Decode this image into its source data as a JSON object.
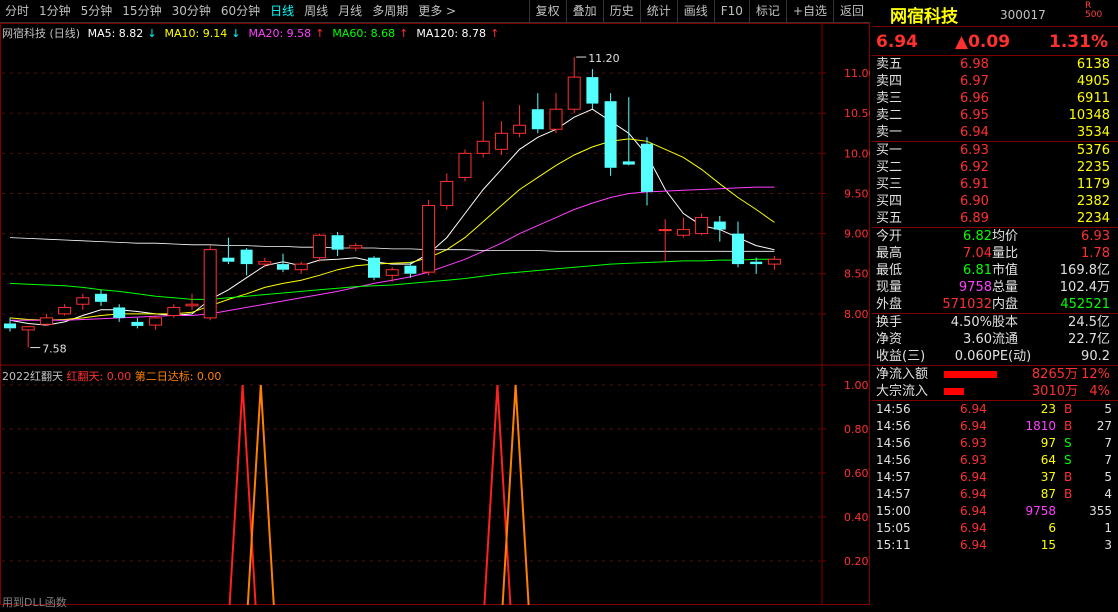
{
  "toolbar": {
    "periods": [
      "分时",
      "1分钟",
      "5分钟",
      "15分钟",
      "30分钟",
      "60分钟",
      "日线",
      "周线",
      "月线",
      "多周期",
      "更多 >"
    ],
    "active_index": 6,
    "buttons": [
      "复权",
      "叠加",
      "历史",
      "统计",
      "画线",
      "F10",
      "标记",
      "+自选",
      "返回"
    ]
  },
  "main_chart": {
    "title": "网宿科技 (日线)",
    "ma": [
      {
        "label": "MA5: 8.82",
        "arrow": "↓",
        "color": "#ffffff"
      },
      {
        "label": "MA10: 9.14",
        "arrow": "↓",
        "color": "#ffff00"
      },
      {
        "label": "MA20: 9.58",
        "arrow": "↑",
        "color": "#ff40ff"
      },
      {
        "label": "MA60: 8.68",
        "arrow": "↑",
        "color": "#00ff00"
      },
      {
        "label": "MA120: 8.78",
        "arrow": "↑",
        "color": "#ffffff"
      }
    ],
    "y_ticks": [
      "11.00",
      "10.50",
      "10.00",
      "9.50",
      "9.00",
      "8.50",
      "8.00"
    ],
    "high_label": "11.20",
    "low_label": "7.58",
    "candles": [
      {
        "o": 7.88,
        "h": 7.95,
        "l": 7.78,
        "c": 7.82
      },
      {
        "o": 7.8,
        "h": 7.85,
        "l": 7.58,
        "c": 7.84
      },
      {
        "o": 7.87,
        "h": 8.0,
        "l": 7.85,
        "c": 7.95
      },
      {
        "o": 8.0,
        "h": 8.12,
        "l": 7.98,
        "c": 8.08
      },
      {
        "o": 8.12,
        "h": 8.25,
        "l": 8.05,
        "c": 8.2
      },
      {
        "o": 8.25,
        "h": 8.3,
        "l": 8.1,
        "c": 8.15
      },
      {
        "o": 8.08,
        "h": 8.12,
        "l": 7.9,
        "c": 7.95
      },
      {
        "o": 7.9,
        "h": 7.95,
        "l": 7.82,
        "c": 7.85
      },
      {
        "o": 7.86,
        "h": 7.98,
        "l": 7.8,
        "c": 7.95
      },
      {
        "o": 7.98,
        "h": 8.12,
        "l": 7.95,
        "c": 8.08
      },
      {
        "o": 8.1,
        "h": 8.25,
        "l": 8.05,
        "c": 8.12
      },
      {
        "o": 7.95,
        "h": 8.85,
        "l": 7.92,
        "c": 8.8
      },
      {
        "o": 8.7,
        "h": 8.95,
        "l": 8.62,
        "c": 8.65
      },
      {
        "o": 8.8,
        "h": 8.82,
        "l": 8.48,
        "c": 8.62
      },
      {
        "o": 8.62,
        "h": 8.7,
        "l": 8.58,
        "c": 8.65
      },
      {
        "o": 8.62,
        "h": 8.75,
        "l": 8.52,
        "c": 8.55
      },
      {
        "o": 8.55,
        "h": 8.65,
        "l": 8.5,
        "c": 8.62
      },
      {
        "o": 8.7,
        "h": 9.0,
        "l": 8.65,
        "c": 8.98
      },
      {
        "o": 8.98,
        "h": 9.02,
        "l": 8.72,
        "c": 8.8
      },
      {
        "o": 8.82,
        "h": 8.88,
        "l": 8.78,
        "c": 8.85
      },
      {
        "o": 8.7,
        "h": 8.72,
        "l": 8.42,
        "c": 8.45
      },
      {
        "o": 8.48,
        "h": 8.58,
        "l": 8.4,
        "c": 8.55
      },
      {
        "o": 8.6,
        "h": 8.65,
        "l": 8.45,
        "c": 8.5
      },
      {
        "o": 8.52,
        "h": 9.42,
        "l": 8.48,
        "c": 9.35
      },
      {
        "o": 9.35,
        "h": 9.75,
        "l": 9.3,
        "c": 9.65
      },
      {
        "o": 9.7,
        "h": 10.05,
        "l": 9.65,
        "c": 10.0
      },
      {
        "o": 10.0,
        "h": 10.65,
        "l": 9.95,
        "c": 10.15
      },
      {
        "o": 10.05,
        "h": 10.4,
        "l": 9.98,
        "c": 10.25
      },
      {
        "o": 10.25,
        "h": 10.6,
        "l": 10.2,
        "c": 10.35
      },
      {
        "o": 10.55,
        "h": 10.75,
        "l": 10.25,
        "c": 10.3
      },
      {
        "o": 10.3,
        "h": 10.75,
        "l": 10.25,
        "c": 10.55
      },
      {
        "o": 10.55,
        "h": 11.2,
        "l": 10.5,
        "c": 10.95
      },
      {
        "o": 10.95,
        "h": 11.05,
        "l": 10.55,
        "c": 10.62
      },
      {
        "o": 10.65,
        "h": 10.75,
        "l": 9.72,
        "c": 9.82
      },
      {
        "o": 9.9,
        "h": 10.7,
        "l": 9.85,
        "c": 9.86
      },
      {
        "o": 10.12,
        "h": 10.2,
        "l": 9.35,
        "c": 9.52
      },
      {
        "o": 9.05,
        "h": 9.18,
        "l": 8.65,
        "c": 9.05
      },
      {
        "o": 8.98,
        "h": 9.2,
        "l": 8.95,
        "c": 9.05
      },
      {
        "o": 9.0,
        "h": 9.25,
        "l": 8.98,
        "c": 9.2
      },
      {
        "o": 9.15,
        "h": 9.22,
        "l": 8.9,
        "c": 9.05
      },
      {
        "o": 9.0,
        "h": 9.15,
        "l": 8.58,
        "c": 8.62
      },
      {
        "o": 8.65,
        "h": 8.7,
        "l": 8.5,
        "c": 8.62
      },
      {
        "o": 8.62,
        "h": 8.72,
        "l": 8.55,
        "c": 8.68
      }
    ],
    "ma_lines": {
      "ma5": [
        7.92,
        7.88,
        7.86,
        7.9,
        7.98,
        8.05,
        8.05,
        8.03,
        8.0,
        7.98,
        8.0,
        8.18,
        8.3,
        8.45,
        8.6,
        8.65,
        8.6,
        8.67,
        8.68,
        8.7,
        8.65,
        8.62,
        8.62,
        8.75,
        8.95,
        9.25,
        9.55,
        9.8,
        10.05,
        10.2,
        10.3,
        10.45,
        10.55,
        10.4,
        10.25,
        9.98,
        9.55,
        9.25,
        9.1,
        9.05,
        8.95,
        8.85,
        8.8
      ],
      "ma10": [
        7.95,
        7.93,
        7.92,
        7.93,
        7.95,
        7.98,
        8.0,
        8.0,
        8.0,
        8.0,
        8.02,
        8.1,
        8.18,
        8.25,
        8.33,
        8.38,
        8.42,
        8.48,
        8.55,
        8.6,
        8.62,
        8.63,
        8.64,
        8.7,
        8.8,
        8.95,
        9.15,
        9.35,
        9.55,
        9.7,
        9.85,
        9.98,
        10.08,
        10.15,
        10.18,
        10.15,
        10.05,
        9.95,
        9.8,
        9.62,
        9.45,
        9.3,
        9.14
      ],
      "ma20": [
        7.92,
        7.92,
        7.92,
        7.92,
        7.93,
        7.94,
        7.95,
        7.96,
        7.97,
        7.98,
        7.98,
        8.0,
        8.04,
        8.08,
        8.12,
        8.16,
        8.2,
        8.24,
        8.28,
        8.33,
        8.38,
        8.42,
        8.46,
        8.52,
        8.6,
        8.68,
        8.78,
        8.88,
        9.0,
        9.1,
        9.2,
        9.3,
        9.38,
        9.45,
        9.5,
        9.52,
        9.53,
        9.54,
        9.55,
        9.56,
        9.57,
        9.58,
        9.58
      ],
      "ma60": [
        8.38,
        8.37,
        8.36,
        8.35,
        8.33,
        8.3,
        8.28,
        8.25,
        8.22,
        8.2,
        8.18,
        8.18,
        8.2,
        8.22,
        8.24,
        8.26,
        8.28,
        8.3,
        8.32,
        8.34,
        8.35,
        8.36,
        8.38,
        8.4,
        8.42,
        8.44,
        8.47,
        8.5,
        8.52,
        8.54,
        8.56,
        8.58,
        8.6,
        8.62,
        8.63,
        8.64,
        8.65,
        8.66,
        8.66,
        8.67,
        8.67,
        8.68,
        8.68
      ],
      "ma120": [
        8.95,
        8.94,
        8.93,
        8.92,
        8.91,
        8.9,
        8.89,
        8.88,
        8.88,
        8.87,
        8.86,
        8.86,
        8.85,
        8.85,
        8.84,
        8.84,
        8.83,
        8.83,
        8.82,
        8.82,
        8.82,
        8.81,
        8.81,
        8.8,
        8.8,
        8.8,
        8.79,
        8.79,
        8.79,
        8.79,
        8.78,
        8.78,
        8.78,
        8.78,
        8.78,
        8.78,
        8.78,
        8.78,
        8.78,
        8.78,
        8.78,
        8.78,
        8.78
      ]
    }
  },
  "indicator": {
    "title": "2022红翻天",
    "label1": "红翻天: 0.00",
    "label2": "第二日达标: 0.00",
    "y_ticks": [
      "1.00",
      "0.80",
      "0.60",
      "0.40",
      "0.20"
    ],
    "spikes": [
      {
        "index": 13,
        "series": "red"
      },
      {
        "index": 14,
        "series": "orange"
      },
      {
        "index": 27,
        "series": "red"
      },
      {
        "index": 28,
        "series": "orange"
      }
    ]
  },
  "status_text": "用到DLL函数",
  "panel": {
    "name": "网宿科技",
    "code": "300017",
    "tag_r": "R",
    "tag_num": "500",
    "price": "6.94",
    "change": "▲0.09",
    "change_pct": "1.31%",
    "asks": [
      {
        "label": "卖五",
        "price": "6.98",
        "vol": "6138"
      },
      {
        "label": "卖四",
        "price": "6.97",
        "vol": "4905"
      },
      {
        "label": "卖三",
        "price": "6.96",
        "vol": "6911"
      },
      {
        "label": "卖二",
        "price": "6.95",
        "vol": "10348"
      },
      {
        "label": "卖一",
        "price": "6.94",
        "vol": "3534"
      }
    ],
    "bids": [
      {
        "label": "买一",
        "price": "6.93",
        "vol": "5376"
      },
      {
        "label": "买二",
        "price": "6.92",
        "vol": "2235"
      },
      {
        "label": "买三",
        "price": "6.91",
        "vol": "1179"
      },
      {
        "label": "买四",
        "price": "6.90",
        "vol": "2382"
      },
      {
        "label": "买五",
        "price": "6.89",
        "vol": "2234"
      }
    ],
    "stats": [
      {
        "l1": "今开",
        "v1": "6.82",
        "c1": "green",
        "l2": "均价",
        "v2": "6.93",
        "c2": "red"
      },
      {
        "l1": "最高",
        "v1": "7.04",
        "c1": "red",
        "l2": "量比",
        "v2": "1.78",
        "c2": "red"
      },
      {
        "l1": "最低",
        "v1": "6.81",
        "c1": "green",
        "l2": "市值",
        "v2": "169.8亿",
        "c2": "white"
      },
      {
        "l1": "现量",
        "v1": "9758",
        "c1": "magenta",
        "l2": "总量",
        "v2": "102.4万",
        "c2": "white"
      },
      {
        "l1": "外盘",
        "v1": "571032",
        "c1": "red",
        "l2": "内盘",
        "v2": "452521",
        "c2": "green"
      }
    ],
    "stats2": [
      {
        "l1": "换手",
        "v1": "4.50%",
        "l2": "股本",
        "v2": "24.5亿"
      },
      {
        "l1": "净资",
        "v1": "3.60",
        "l2": "流通",
        "v2": "22.7亿"
      },
      {
        "l1": "收益(三)",
        "v1": "0.060",
        "l2": "PE(动)",
        "v2": "90.2"
      }
    ],
    "flows": [
      {
        "label": "净流入额",
        "value": "8265万",
        "pct": "12%",
        "bar": 0.95
      },
      {
        "label": "大宗流入",
        "value": "3010万",
        "pct": "4%",
        "bar": 0.35
      }
    ],
    "ticks": [
      {
        "time": "14:56",
        "price": "6.94",
        "vol": "23",
        "side": "B",
        "n": "5"
      },
      {
        "time": "14:56",
        "price": "6.94",
        "vol": "1810",
        "side": "B",
        "n": "27"
      },
      {
        "time": "14:56",
        "price": "6.93",
        "vol": "97",
        "side": "S",
        "n": "7"
      },
      {
        "time": "14:56",
        "price": "6.93",
        "vol": "64",
        "side": "S",
        "n": "7"
      },
      {
        "time": "14:57",
        "price": "6.94",
        "vol": "37",
        "side": "B",
        "n": "5"
      },
      {
        "time": "14:57",
        "price": "6.94",
        "vol": "87",
        "side": "B",
        "n": "4"
      },
      {
        "time": "15:00",
        "price": "6.94",
        "vol": "9758",
        "side": "",
        "n": "355"
      },
      {
        "time": "15:05",
        "price": "6.94",
        "vol": "6",
        "side": "",
        "n": "1"
      },
      {
        "time": "15:11",
        "price": "6.94",
        "vol": "15",
        "side": "",
        "n": "3"
      }
    ]
  }
}
